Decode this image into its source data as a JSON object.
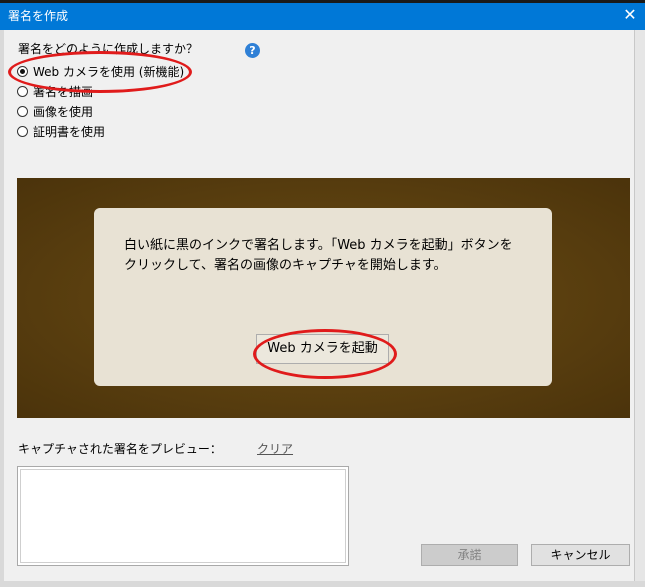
{
  "window": {
    "title": "署名を作成",
    "close_glyph": "✕"
  },
  "method": {
    "question": "署名をどのように作成しますか？",
    "help_glyph": "?",
    "options": [
      {
        "label": "Web カメラを使用 (新機能)",
        "selected": true
      },
      {
        "label": "署名を描画",
        "selected": false
      },
      {
        "label": "画像を使用",
        "selected": false
      },
      {
        "label": "証明書を使用",
        "selected": false
      }
    ]
  },
  "camera": {
    "instruction": "白い紙に黒のインクで署名します。「Web カメラを起動」ボタンをクリックして、署名の画像のキャプチャを開始します。",
    "start_button": "Web カメラを起動"
  },
  "preview": {
    "label": "キャプチャされた署名をプレビュー：",
    "clear_link": "クリア"
  },
  "buttons": {
    "approve": "承諾",
    "cancel": "キャンセル"
  },
  "colors": {
    "titlebar": "#0078d7",
    "highlight": "#e01b1b",
    "camera_background": "#5a3f0f"
  }
}
